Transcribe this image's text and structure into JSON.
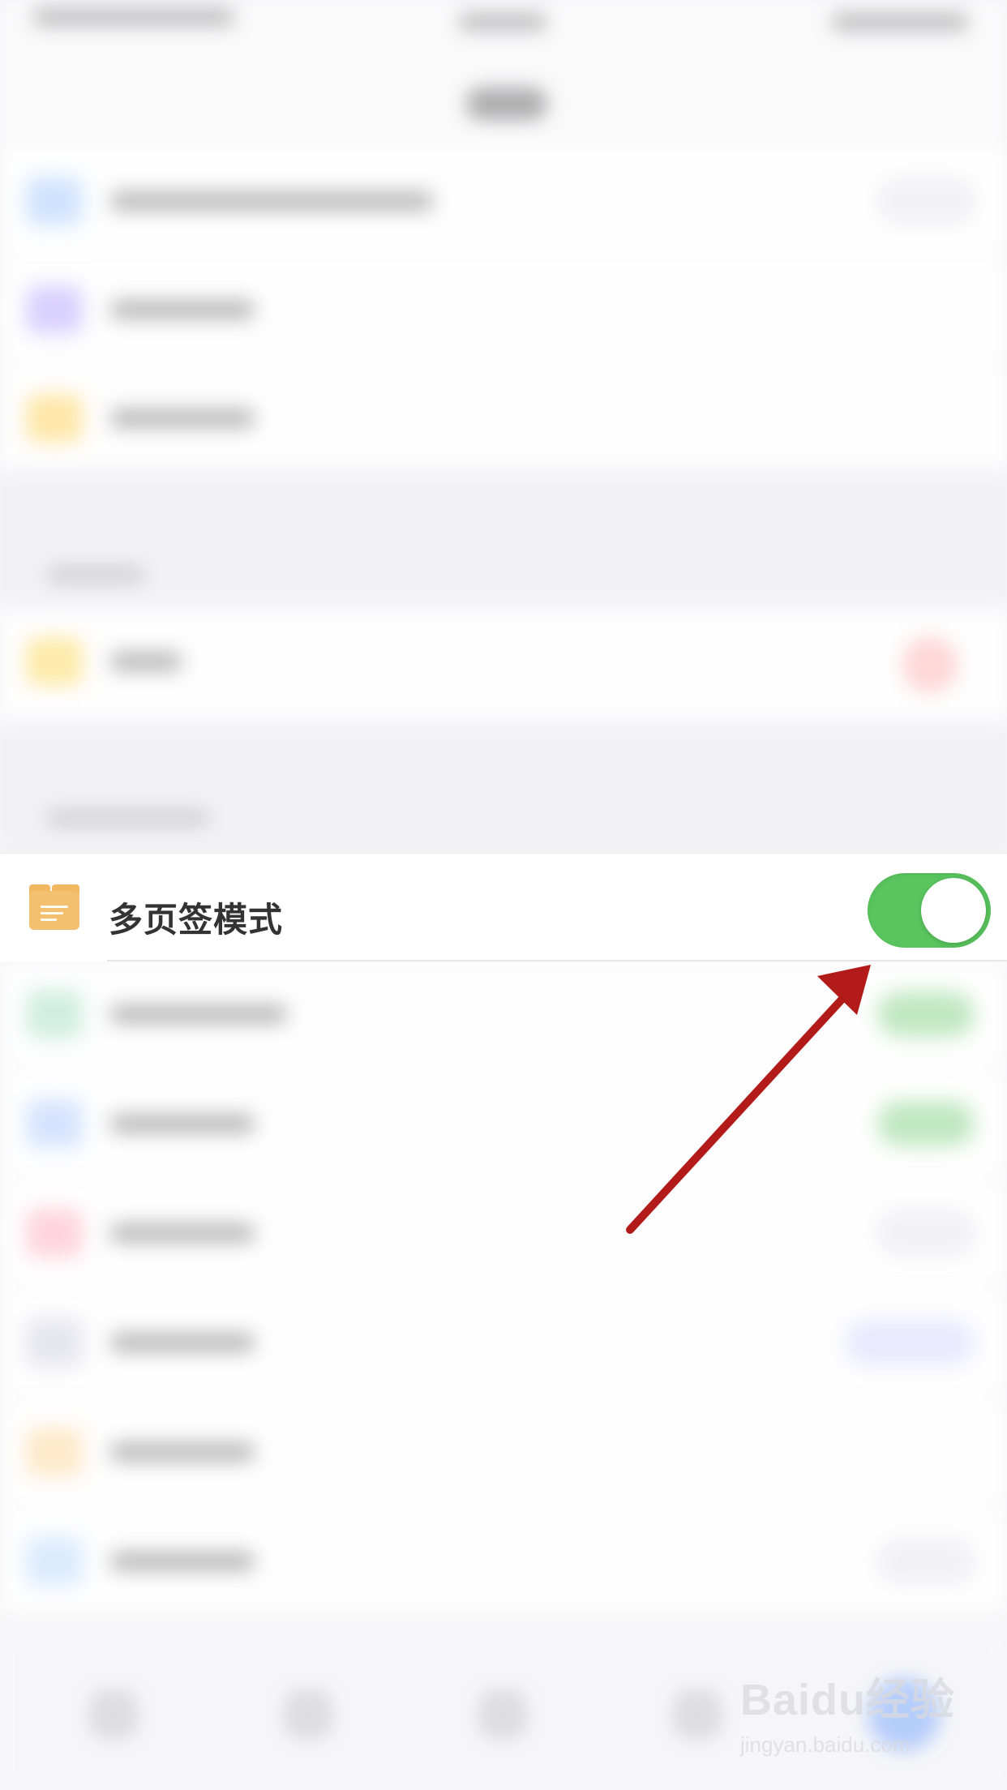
{
  "screen": {
    "focused_setting": {
      "label": "多页签模式",
      "icon": "folder-icon",
      "toggle_state": "on",
      "toggle_color": "#5ac55f"
    }
  },
  "watermark": {
    "brand": "Baidu经验",
    "url": "jingyan.baidu.com"
  }
}
